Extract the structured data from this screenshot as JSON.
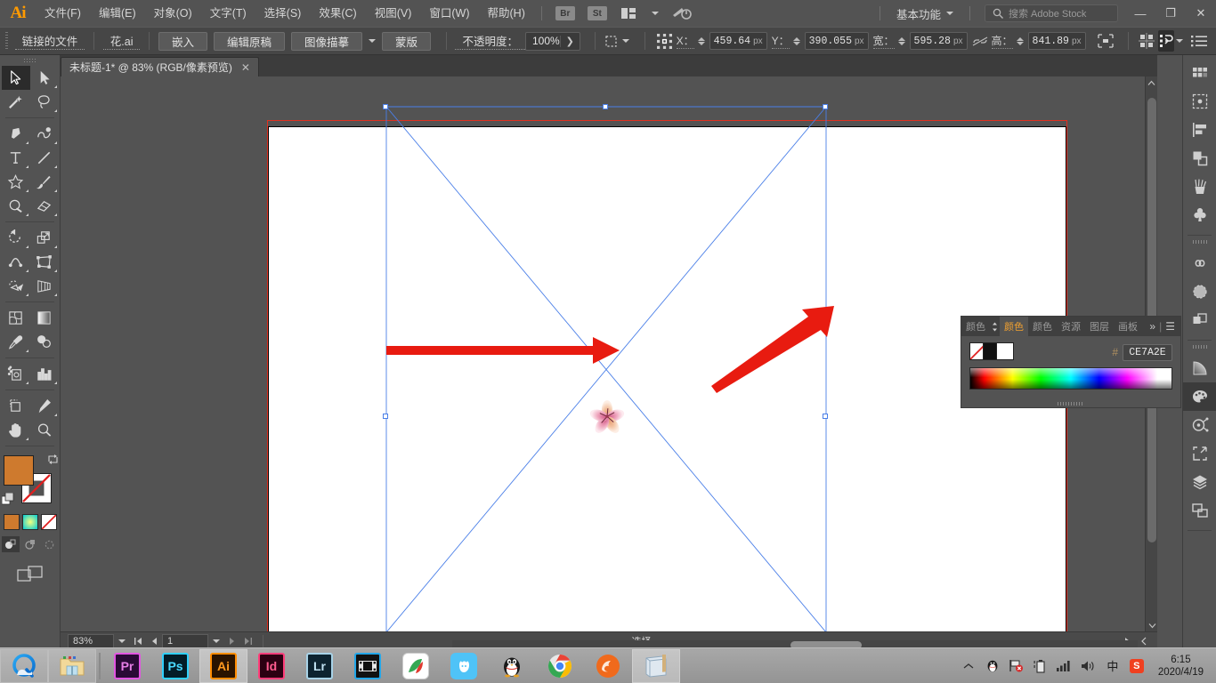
{
  "app": {
    "logo": "Ai"
  },
  "menubar": {
    "items": [
      {
        "label": "文件(F)",
        "name": "menu-file"
      },
      {
        "label": "编辑(E)",
        "name": "menu-edit"
      },
      {
        "label": "对象(O)",
        "name": "menu-object"
      },
      {
        "label": "文字(T)",
        "name": "menu-type"
      },
      {
        "label": "选择(S)",
        "name": "menu-select"
      },
      {
        "label": "效果(C)",
        "name": "menu-effect"
      },
      {
        "label": "视图(V)",
        "name": "menu-view"
      },
      {
        "label": "窗口(W)",
        "name": "menu-window"
      },
      {
        "label": "帮助(H)",
        "name": "menu-help"
      }
    ],
    "bridge_label": "Br",
    "stock_label": "St",
    "workspace": "基本功能",
    "search_placeholder": "搜索 Adobe Stock",
    "minimize": "—",
    "maximize": "❐",
    "close": "✕"
  },
  "controlbar": {
    "linked_file_label": "链接的文件",
    "file_name": "花.ai",
    "embed_button": "嵌入",
    "edit_original_button": "编辑原稿",
    "image_trace_button": "图像描摹",
    "mask_button": "蒙版",
    "opacity_label": "不透明度：",
    "opacity_value": "100%",
    "x_label": "X：",
    "x_value": "459.64",
    "x_unit": "px",
    "y_label": "Y：",
    "y_value": "390.055",
    "y_unit": "px",
    "w_label": "宽：",
    "w_value": "595.28",
    "w_unit": "px",
    "h_label": "高：",
    "h_value": "841.89",
    "h_unit": "px"
  },
  "tab": {
    "title": "未标题-1* @ 83% (RGB/像素预览)",
    "close": "✕"
  },
  "toolbar": {
    "tools": [
      {
        "name": "selection-tool",
        "selected": true
      },
      {
        "name": "direct-selection-tool",
        "selected": false
      },
      {
        "name": "magic-wand-tool",
        "selected": false
      },
      {
        "name": "lasso-tool",
        "selected": false
      },
      {
        "name": "pen-tool",
        "selected": false
      },
      {
        "name": "curvature-tool",
        "selected": false
      },
      {
        "name": "type-tool",
        "selected": false
      },
      {
        "name": "line-segment-tool",
        "selected": false
      },
      {
        "name": "shape-tool",
        "selected": false
      },
      {
        "name": "paintbrush-tool",
        "selected": false
      },
      {
        "name": "shaper-tool",
        "selected": false
      },
      {
        "name": "eraser-tool",
        "selected": false
      },
      {
        "name": "rotate-tool",
        "selected": false
      },
      {
        "name": "scale-tool",
        "selected": false
      },
      {
        "name": "width-tool",
        "selected": false
      },
      {
        "name": "free-transform-tool",
        "selected": false
      },
      {
        "name": "shape-builder-tool",
        "selected": false
      },
      {
        "name": "perspective-grid-tool",
        "selected": false
      },
      {
        "name": "mesh-tool",
        "selected": false
      },
      {
        "name": "gradient-tool",
        "selected": false
      },
      {
        "name": "eyedropper-tool",
        "selected": false
      },
      {
        "name": "blend-tool",
        "selected": false
      },
      {
        "name": "symbol-sprayer-tool",
        "selected": false
      },
      {
        "name": "column-graph-tool",
        "selected": false
      },
      {
        "name": "artboard-tool",
        "selected": false
      },
      {
        "name": "slice-tool",
        "selected": false
      },
      {
        "name": "hand-tool",
        "selected": false
      },
      {
        "name": "zoom-tool",
        "selected": false
      }
    ],
    "fill_color": "#ce7a2e",
    "stroke_color": "#ffffff",
    "mini_swatches": [
      "#ce7a2e",
      "gradient",
      "none"
    ],
    "draw_modes": [
      "normal",
      "behind",
      "inside"
    ]
  },
  "canvas": {
    "artboard_background": "#ffffff",
    "selection_color": "#4a7fe8",
    "bleed_color": "#e03020",
    "arrows": [
      {
        "name": "annotation-arrow-left",
        "color": "#e81b10"
      },
      {
        "name": "annotation-arrow-right",
        "color": "#e81b10"
      }
    ],
    "artwork": "flower-image"
  },
  "statusbar": {
    "zoom_value": "83%",
    "page_value": "1",
    "tool_status": "选择"
  },
  "colorpanel": {
    "tabs": [
      {
        "label": "颜色",
        "name": "panel-tab-color-guide",
        "active": false
      },
      {
        "label": "颜色",
        "name": "panel-tab-color",
        "active": true
      },
      {
        "label": "颜色",
        "name": "panel-tab-color-2",
        "active": false
      },
      {
        "label": "资源",
        "name": "panel-tab-assets",
        "active": false
      },
      {
        "label": "图层",
        "name": "panel-tab-layers",
        "active": false
      },
      {
        "label": "画板",
        "name": "panel-tab-artboards",
        "active": false
      }
    ],
    "overflow": "»",
    "menu_icon": "☰",
    "hash_label": "#",
    "hex_value": "CE7A2E",
    "fill_swatch": "none",
    "stroke_swatch": "#000000",
    "white_swatch": "#ffffff"
  },
  "rightdock": {
    "items": [
      {
        "name": "dock-icon-swatches"
      },
      {
        "name": "dock-icon-brushes-frame"
      },
      {
        "name": "dock-icon-align"
      },
      {
        "name": "dock-icon-pathfinder"
      },
      {
        "name": "dock-icon-brushes"
      },
      {
        "name": "dock-icon-symbols"
      },
      {
        "name": "dock-icon-creative-cloud-libraries"
      },
      {
        "name": "dock-icon-image-trace"
      },
      {
        "name": "dock-icon-transform"
      },
      {
        "name": "dock-icon-gradient"
      },
      {
        "name": "dock-icon-color"
      },
      {
        "name": "dock-icon-color-guide"
      },
      {
        "name": "dock-icon-export"
      },
      {
        "name": "dock-icon-layers"
      },
      {
        "name": "dock-icon-artboards"
      }
    ]
  },
  "taskbar": {
    "items": [
      {
        "name": "taskbar-qq-browser",
        "label": ""
      },
      {
        "name": "taskbar-file-explorer",
        "label": ""
      },
      {
        "name": "taskbar-premiere",
        "label": "Pr"
      },
      {
        "name": "taskbar-photoshop",
        "label": "Ps"
      },
      {
        "name": "taskbar-illustrator",
        "label": "Ai"
      },
      {
        "name": "taskbar-indesign",
        "label": "Id"
      },
      {
        "name": "taskbar-lightroom",
        "label": "Lr"
      },
      {
        "name": "taskbar-media-player",
        "label": ""
      },
      {
        "name": "taskbar-pdf-reader",
        "label": ""
      },
      {
        "name": "taskbar-rabbit-app",
        "label": ""
      },
      {
        "name": "taskbar-qq",
        "label": ""
      },
      {
        "name": "taskbar-chrome",
        "label": ""
      },
      {
        "name": "taskbar-firefox",
        "label": ""
      },
      {
        "name": "taskbar-notepad",
        "label": ""
      }
    ],
    "tray": {
      "ime_label": "中",
      "sogou_label": "S",
      "time": "6:15",
      "date": "2020/4/19"
    }
  }
}
